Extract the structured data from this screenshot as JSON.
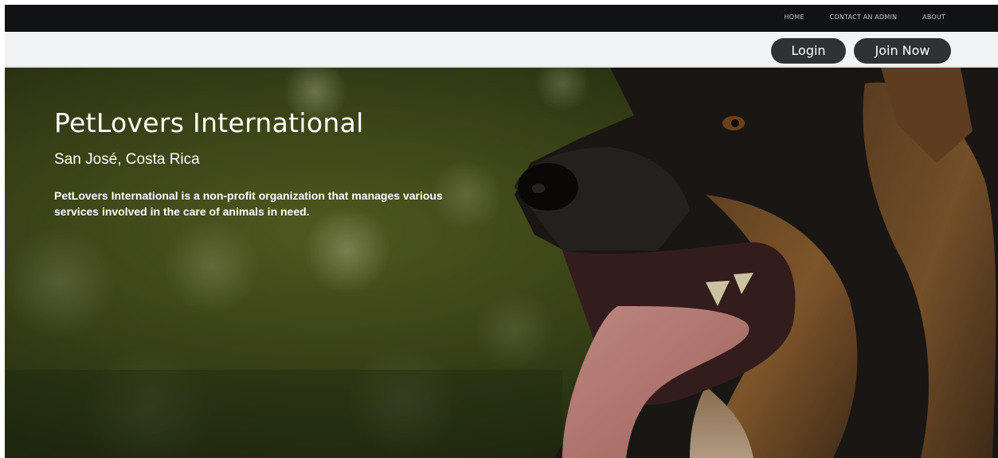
{
  "nav": {
    "home": "HOME",
    "contact": "CONTACT AN ADMIN",
    "about": "ABOUT"
  },
  "auth": {
    "login": "Login",
    "join": "Join Now"
  },
  "hero": {
    "title": "PetLovers International",
    "location": "San José, Costa Rica",
    "description": "PetLovers International is a non-profit organization that manages various services involved in the care of animals in need.",
    "image": "german-shepherd-dog-photo"
  },
  "colors": {
    "topbar": "#111213",
    "authbar": "#f2f3f4",
    "button": "#2f3133",
    "hero_bg": "#2c3515",
    "text_light": "#ffffff"
  }
}
